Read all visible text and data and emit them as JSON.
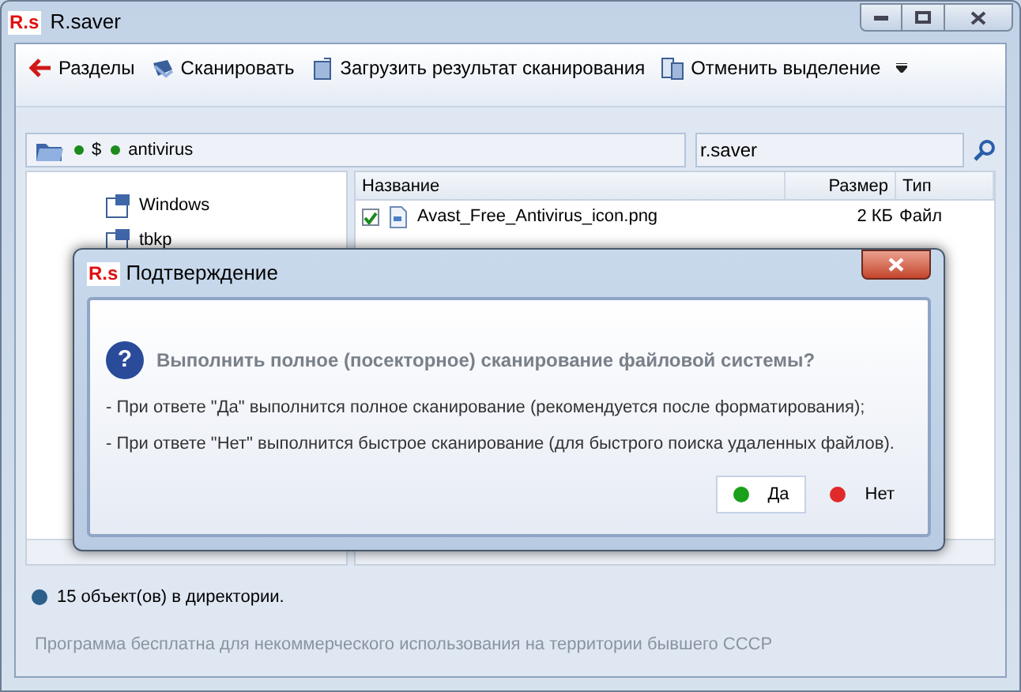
{
  "window": {
    "logo": "R.s",
    "title": "R.saver"
  },
  "toolbar": [
    {
      "kind": "back",
      "label": "Разделы"
    },
    {
      "kind": "scan",
      "label": "Сканировать"
    },
    {
      "kind": "load",
      "label": "Загрузить результат сканирования"
    },
    {
      "kind": "deselect",
      "label": "Отменить выделение"
    }
  ],
  "path_bar": {
    "segments": [
      "$",
      "antivirus"
    ]
  },
  "search": {
    "value": "r.saver"
  },
  "tree": {
    "items": [
      {
        "label": "Windows"
      },
      {
        "label": "tbkp"
      }
    ]
  },
  "file_list": {
    "columns": [
      "Название",
      "Размер",
      "Тип"
    ],
    "rows": [
      {
        "name": "Avast_Free_Antivirus_icon.png",
        "size": "2 КБ",
        "type": "Файл",
        "checked": true
      }
    ]
  },
  "status_bar": {
    "text": "15 объект(ов) в директории.",
    "note": "Программа бесплатна для некоммерческого использования на территории бывшего СССР"
  },
  "dialog": {
    "logo": "R.s",
    "title": "Подтверждение",
    "icon": "?",
    "question": "Выполнить полное (посекторное) сканирование файловой системы?",
    "lines": [
      "- При ответе \"Да\" выполнится полное сканирование (рекомендуется после форматирования);",
      "- При ответе \"Нет\" выполнится быстрое сканирование (для быстрого поиска удаленных файлов)."
    ],
    "buttons": [
      {
        "label": "Да",
        "kind": "yes",
        "selected": true
      },
      {
        "label": "Нет",
        "kind": "no",
        "selected": false
      }
    ]
  }
}
